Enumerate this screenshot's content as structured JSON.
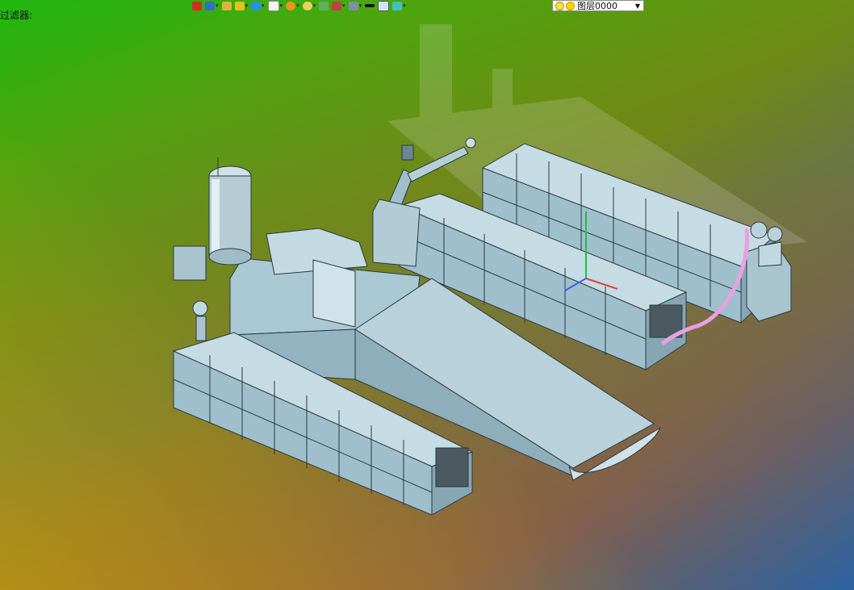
{
  "status": {
    "prompt_text": "过滤器:"
  },
  "toolbar": {
    "icons": [
      "exit-icon",
      "view-icon",
      "pen-icon",
      "layer-icon",
      "cube-icon",
      "box-icon",
      "render-icon",
      "zoom-icon",
      "doc-icon",
      "color-icon",
      "display-icon",
      "line-icon",
      "fill-icon",
      "shade-icon"
    ],
    "layer_select": {
      "value": "图层0000"
    }
  },
  "colors": {
    "model_face": "#a9c8d4",
    "model_dark": "#7fa0ae",
    "model_light": "#c9dde5",
    "hose": "#e8a0e0"
  }
}
